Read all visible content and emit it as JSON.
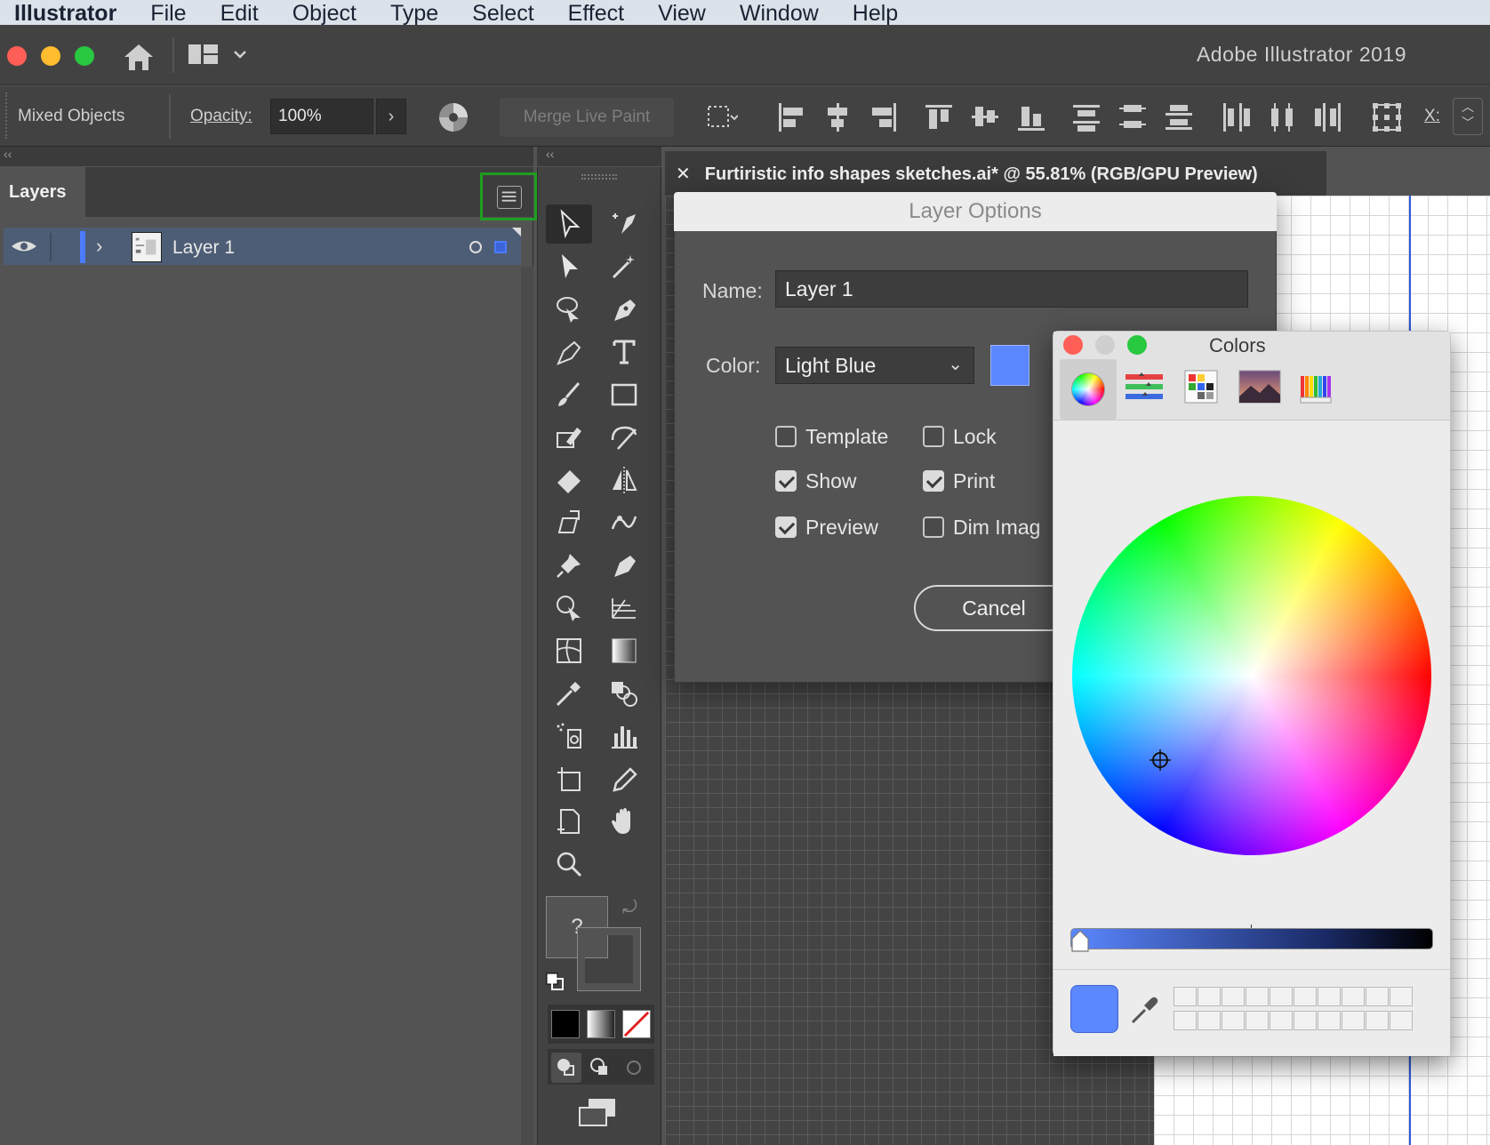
{
  "menubar": {
    "app": "Illustrator",
    "items": [
      "File",
      "Edit",
      "Object",
      "Type",
      "Select",
      "Effect",
      "View",
      "Window",
      "Help"
    ]
  },
  "appbar": {
    "title": "Adobe Illustrator 2019"
  },
  "controlbar": {
    "selection_label": "Mixed Objects",
    "opacity_label": "Opacity:",
    "opacity_value": "100%",
    "merge_label": "Merge Live Paint",
    "x_label": "X:"
  },
  "layers": {
    "tab": "Layers",
    "rows": [
      {
        "name": "Layer 1"
      }
    ]
  },
  "document": {
    "tab_title": "Furtiristic info shapes sketches.ai* @ 55.81% (RGB/GPU Preview)"
  },
  "layer_options": {
    "title": "Layer Options",
    "name_label": "Name:",
    "name_value": "Layer 1",
    "color_label": "Color:",
    "color_value": "Light Blue",
    "swatch_color": "#5b87ff",
    "checkboxes": {
      "template": {
        "label": "Template",
        "checked": false
      },
      "lock": {
        "label": "Lock",
        "checked": false
      },
      "show": {
        "label": "Show",
        "checked": true
      },
      "print": {
        "label": "Print",
        "checked": true
      },
      "preview": {
        "label": "Preview",
        "checked": true
      },
      "dim": {
        "label": "Dim Imag",
        "checked": false
      }
    },
    "cancel_label": "Cancel"
  },
  "colors_panel": {
    "title": "Colors",
    "current_color": "#5b87ff",
    "tabs": [
      "color-wheel-icon",
      "sliders-icon",
      "palettes-icon",
      "image-palettes-icon",
      "pencils-icon"
    ]
  },
  "toolbox": {
    "fill_stroke_placeholder": "?"
  },
  "colors": {
    "accent_selection": "#4b7bff",
    "highlight_frame": "#1f9d1f"
  }
}
